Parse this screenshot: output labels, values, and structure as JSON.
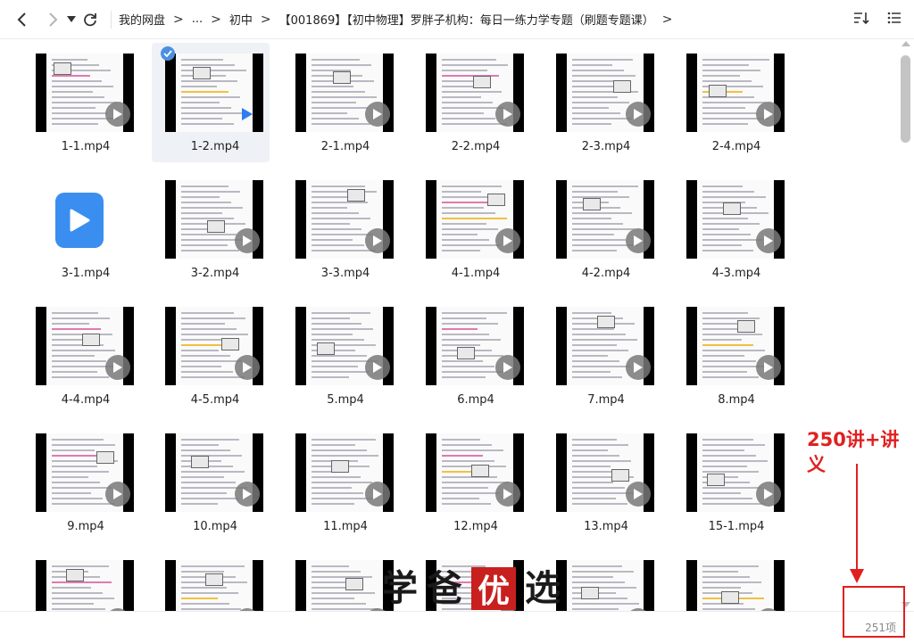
{
  "toolbar": {
    "breadcrumbs": [
      "我的网盘",
      "...",
      "初中",
      "【001869】【初中物理】罗胖子机构：每日一练力学专题（刷题专题课）"
    ],
    "separator": ">"
  },
  "files": [
    {
      "name": "1-1.mp4",
      "selected": false,
      "thumbnail": "video-frame"
    },
    {
      "name": "1-2.mp4",
      "selected": true,
      "thumbnail": "video-frame"
    },
    {
      "name": "2-1.mp4",
      "selected": false,
      "thumbnail": "video-frame"
    },
    {
      "name": "2-2.mp4",
      "selected": false,
      "thumbnail": "video-frame"
    },
    {
      "name": "2-3.mp4",
      "selected": false,
      "thumbnail": "video-frame"
    },
    {
      "name": "2-4.mp4",
      "selected": false,
      "thumbnail": "video-frame"
    },
    {
      "name": "3-1.mp4",
      "selected": false,
      "thumbnail": "video-file-icon"
    },
    {
      "name": "3-2.mp4",
      "selected": false,
      "thumbnail": "video-frame"
    },
    {
      "name": "3-3.mp4",
      "selected": false,
      "thumbnail": "video-frame"
    },
    {
      "name": "4-1.mp4",
      "selected": false,
      "thumbnail": "video-frame"
    },
    {
      "name": "4-2.mp4",
      "selected": false,
      "thumbnail": "video-frame"
    },
    {
      "name": "4-3.mp4",
      "selected": false,
      "thumbnail": "video-frame"
    },
    {
      "name": "4-4.mp4",
      "selected": false,
      "thumbnail": "video-frame"
    },
    {
      "name": "4-5.mp4",
      "selected": false,
      "thumbnail": "video-frame"
    },
    {
      "name": "5.mp4",
      "selected": false,
      "thumbnail": "video-frame"
    },
    {
      "name": "6.mp4",
      "selected": false,
      "thumbnail": "video-frame"
    },
    {
      "name": "7.mp4",
      "selected": false,
      "thumbnail": "video-frame"
    },
    {
      "name": "8.mp4",
      "selected": false,
      "thumbnail": "video-frame"
    },
    {
      "name": "9.mp4",
      "selected": false,
      "thumbnail": "video-frame"
    },
    {
      "name": "10.mp4",
      "selected": false,
      "thumbnail": "video-frame"
    },
    {
      "name": "11.mp4",
      "selected": false,
      "thumbnail": "video-frame"
    },
    {
      "name": "12.mp4",
      "selected": false,
      "thumbnail": "video-frame"
    },
    {
      "name": "13.mp4",
      "selected": false,
      "thumbnail": "video-frame"
    },
    {
      "name": "15-1.mp4",
      "selected": false,
      "thumbnail": "video-frame"
    },
    {
      "name": "",
      "selected": false,
      "thumbnail": "video-frame"
    },
    {
      "name": "",
      "selected": false,
      "thumbnail": "video-frame"
    },
    {
      "name": "",
      "selected": false,
      "thumbnail": "video-frame"
    },
    {
      "name": "",
      "selected": false,
      "thumbnail": "video-frame"
    },
    {
      "name": "",
      "selected": false,
      "thumbnail": "video-frame"
    },
    {
      "name": "",
      "selected": false,
      "thumbnail": "video-frame"
    }
  ],
  "footer": {
    "item_count": "251项"
  },
  "annotation": {
    "text": "250讲+讲义",
    "color": "#e02020"
  },
  "watermark": {
    "chars": [
      "学",
      "爸",
      "优",
      "选"
    ]
  },
  "colors": {
    "accent": "#3a8ef0",
    "selected_bg": "#eef1f6",
    "annotation_red": "#e02020"
  }
}
